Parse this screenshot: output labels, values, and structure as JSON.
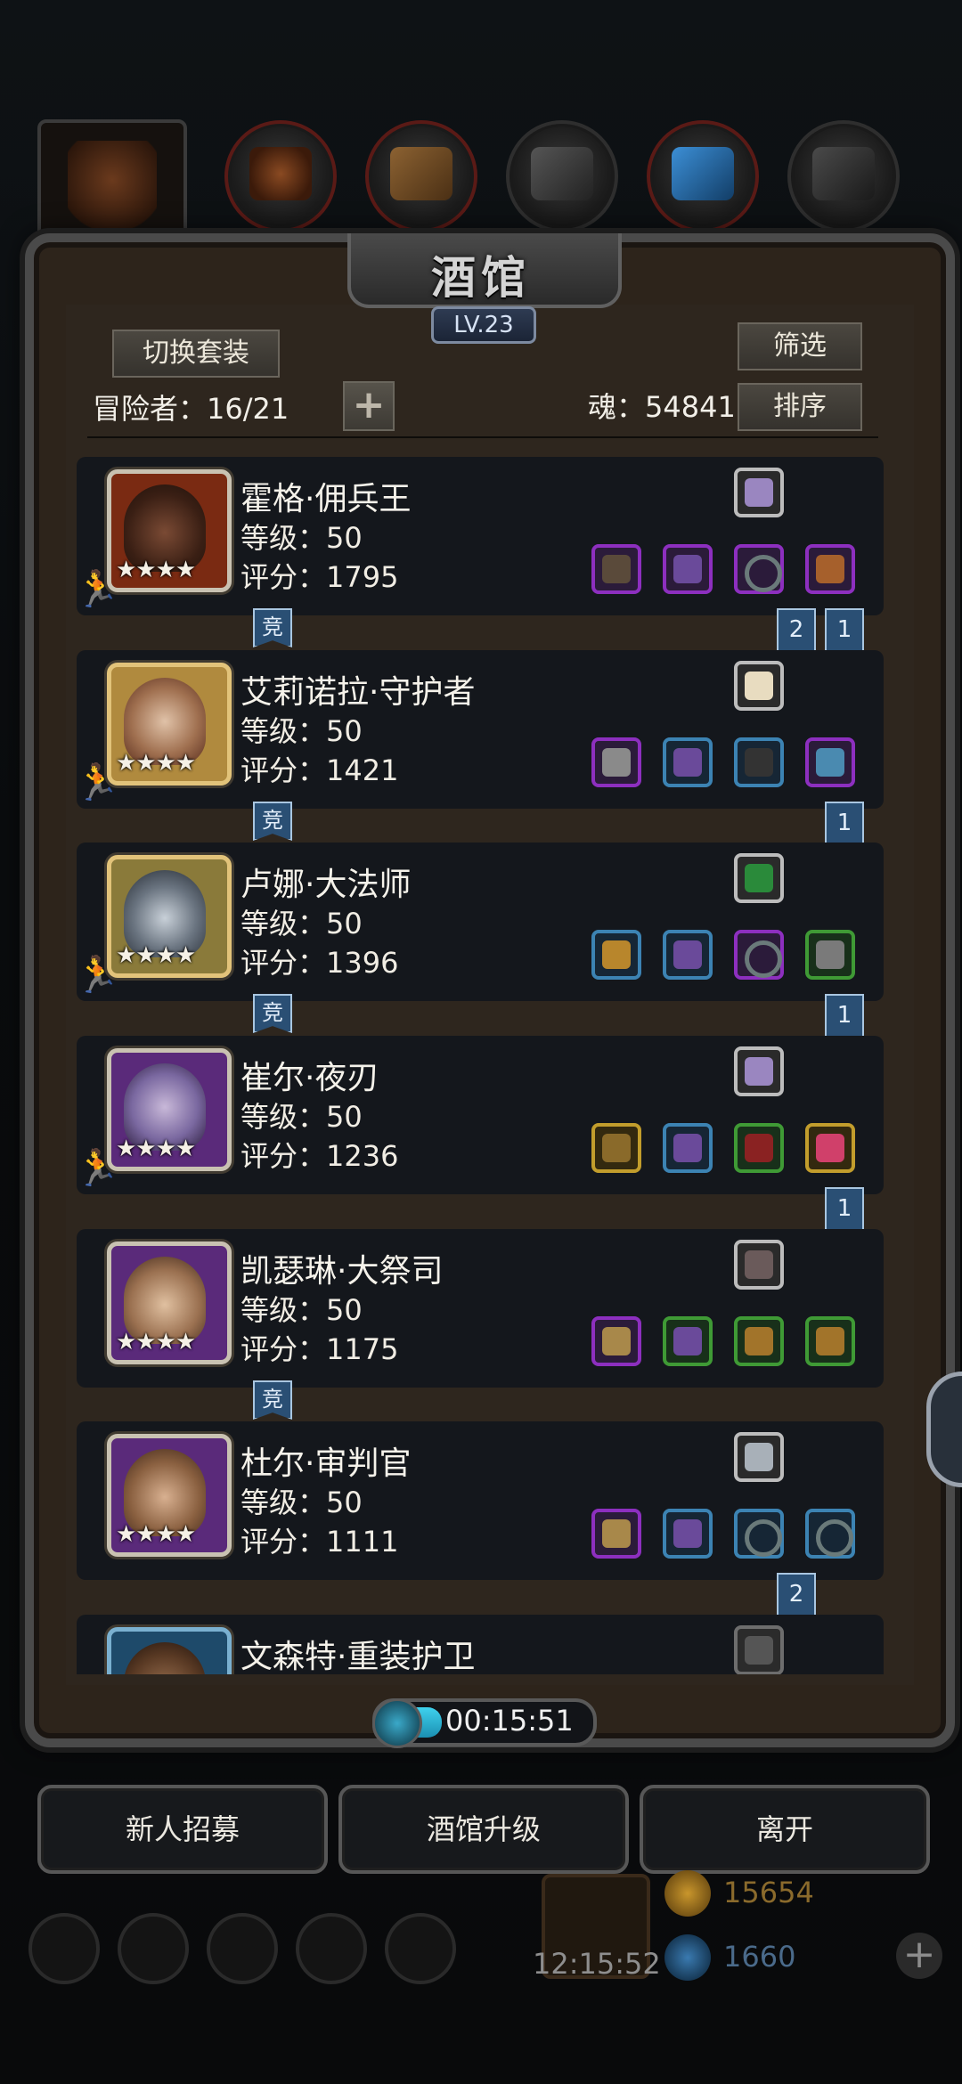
{
  "tavern": {
    "title": "酒馆",
    "level": "LV.23",
    "switch_outfit_label": "切换套装",
    "filter_label": "筛选",
    "sort_label": "排序",
    "adventurers_text": "冒险者：16/21",
    "soul_text": "魂：54841",
    "plus_label": "+"
  },
  "heroes": [
    {
      "name": "霍格·佣兵王",
      "level": "等级：50",
      "score": "评分：1795",
      "stars": "★★★★",
      "arena": "竞",
      "ribbons": [
        "2",
        "1"
      ]
    },
    {
      "name": "艾莉诺拉·守护者",
      "level": "等级：50",
      "score": "评分：1421",
      "stars": "★★★★",
      "arena": "竞",
      "ribbons": [
        "1"
      ]
    },
    {
      "name": "卢娜·大法师",
      "level": "等级：50",
      "score": "评分：1396",
      "stars": "★★★★",
      "arena": "竞",
      "ribbons": [
        "1"
      ]
    },
    {
      "name": "崔尔·夜刃",
      "level": "等级：50",
      "score": "评分：1236",
      "stars": "★★★★",
      "arena": "",
      "ribbons": [
        "1"
      ]
    },
    {
      "name": "凯瑟琳·大祭司",
      "level": "等级：50",
      "score": "评分：1175",
      "stars": "★★★★",
      "arena": "竞",
      "ribbons": []
    },
    {
      "name": "杜尔·审判官",
      "level": "等级：50",
      "score": "评分：1111",
      "stars": "★★★★",
      "arena": "",
      "ribbons": [
        "2"
      ]
    },
    {
      "name": "文森特·重装护卫",
      "level": "",
      "score": "",
      "stars": "",
      "arena": "",
      "ribbons": []
    }
  ],
  "timer": {
    "value": "00:15:51",
    "progress": 0.28
  },
  "actions": {
    "recruit_label": "新人招募",
    "upgrade_label": "酒馆升级",
    "leave_label": "离开"
  },
  "resources": {
    "gold": "15654",
    "gems": "1660",
    "clock": "12:15:52",
    "add_label": "+"
  },
  "colors": {
    "rarity_purple": "#8d2fbf",
    "rarity_blue": "#3c83b3",
    "rarity_green": "#3f9a35",
    "rarity_gold": "#c29d2c",
    "timer_cyan": "#3fd2ee"
  }
}
